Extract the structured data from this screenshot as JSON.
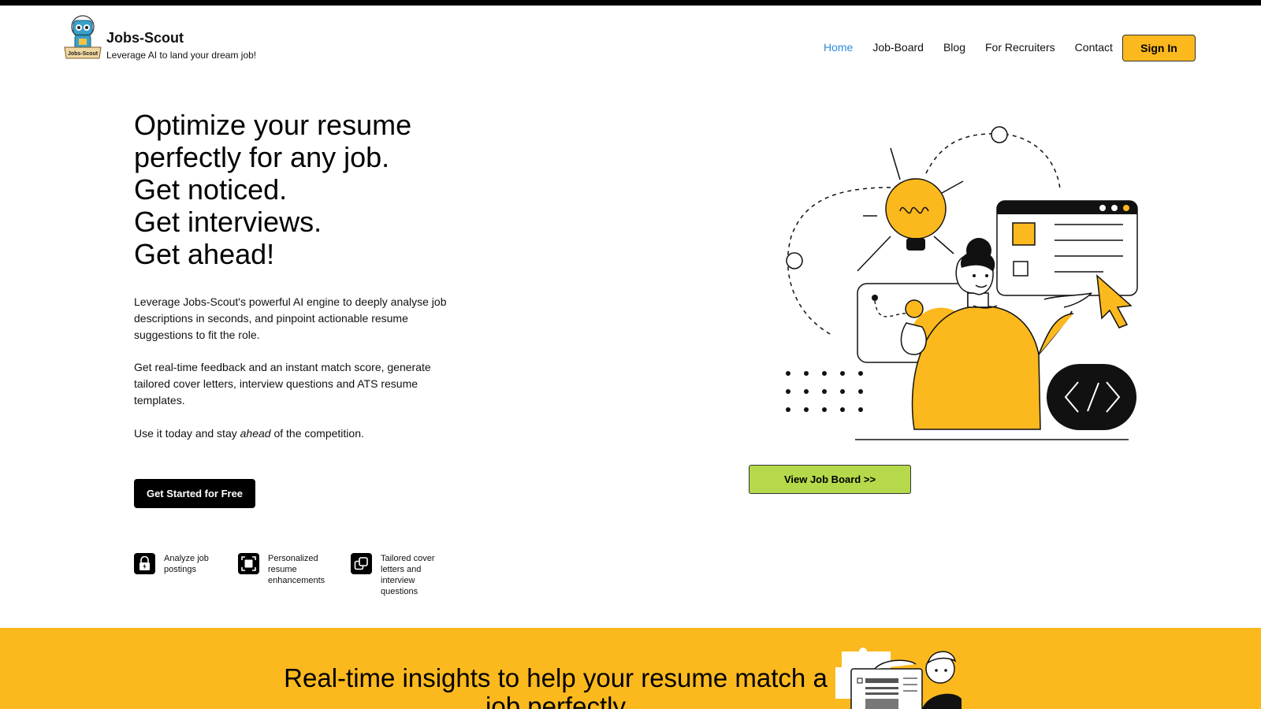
{
  "brand": {
    "name": "Jobs-Scout",
    "tagline": "Leverage AI to land your dream job!",
    "logo_text": "Jobs-Scout"
  },
  "nav": {
    "items": [
      {
        "label": "Home",
        "active": true
      },
      {
        "label": "Job-Board",
        "active": false
      },
      {
        "label": "Blog",
        "active": false
      },
      {
        "label": "For Recruiters",
        "active": false
      },
      {
        "label": "Contact",
        "active": false
      }
    ],
    "signin_label": "Sign In"
  },
  "hero": {
    "title_lines": [
      "Optimize your resume",
      "perfectly for any job.",
      "Get noticed.",
      "Get interviews.",
      "Get ahead!"
    ],
    "p1": "Leverage Jobs-Scout's powerful AI engine to deeply analyse job descriptions in seconds, and pinpoint actionable resume suggestions to fit the role.",
    "p2": "Get real-time feedback and an instant match score, generate tailored cover letters, interview questions and ATS resume templates.",
    "p3_before": "Use it today and stay ",
    "p3_emphasis": "ahead",
    "p3_after": " of the competition.",
    "cta_label": "Get Started for Free",
    "view_job_board_label": "View Job Board >>"
  },
  "features": [
    {
      "icon": "lock-bolt-icon",
      "label": "Analyze job postings"
    },
    {
      "icon": "frame-square-icon",
      "label": "Personalized resume enhancements"
    },
    {
      "icon": "overlap-squares-icon",
      "label": "Tailored cover letters and interview questions"
    }
  ],
  "band": {
    "title": "Real-time insights to help your resume match a job perfectly"
  },
  "colors": {
    "accent_yellow": "#fbb91e",
    "accent_green": "#b5d94a",
    "nav_active": "#2d8ddb",
    "dark": "#000000"
  }
}
